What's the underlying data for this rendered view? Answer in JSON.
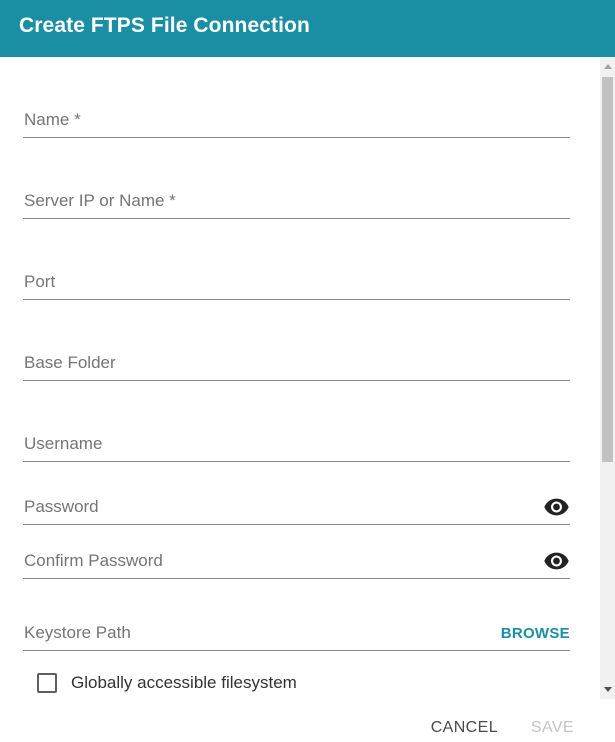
{
  "header": {
    "title": "Create FTPS File Connection"
  },
  "form": {
    "name": {
      "label": "Name *",
      "value": ""
    },
    "server": {
      "label": "Server IP or Name *",
      "value": ""
    },
    "port": {
      "label": "Port",
      "value": ""
    },
    "base_folder": {
      "label": "Base Folder",
      "value": ""
    },
    "username": {
      "label": "Username",
      "value": ""
    },
    "password": {
      "label": "Password",
      "value": "",
      "icon": "eye-icon"
    },
    "confirm_password": {
      "label": "Confirm Password",
      "value": "",
      "icon": "eye-icon"
    },
    "keystore_path": {
      "label": "Keystore Path",
      "value": "",
      "browse_label": "BROWSE"
    },
    "global_checkbox": {
      "label": "Globally accessible filesystem",
      "checked": false
    }
  },
  "footer": {
    "cancel_label": "CANCEL",
    "save_label": "SAVE"
  },
  "colors": {
    "accent": "#1a8fa3",
    "label": "#757575",
    "disabled": "#c4c4c4"
  }
}
